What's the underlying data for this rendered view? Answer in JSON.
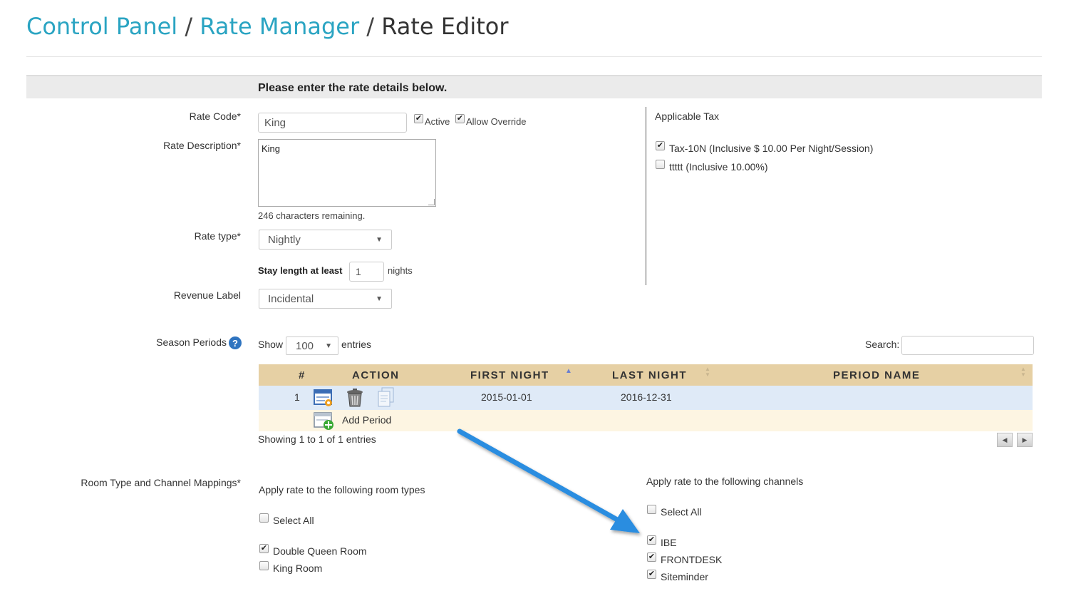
{
  "breadcrumb": {
    "control_panel": "Control Panel",
    "rate_manager": "Rate Manager",
    "rate_editor": "Rate Editor",
    "separator": "/"
  },
  "banner": {
    "text": "Please enter the rate details below."
  },
  "form": {
    "rate_code": {
      "label": "Rate Code*",
      "value": "King",
      "active_label": "Active",
      "active_checked": true,
      "allow_override_label": "Allow Override",
      "allow_override_checked": true
    },
    "rate_description": {
      "label": "Rate Description*",
      "value": "King",
      "remaining": "246 characters remaining."
    },
    "rate_type": {
      "label": "Rate type*",
      "value": "Nightly"
    },
    "stay_length": {
      "label": "Stay length at least",
      "value": "1",
      "unit": "nights"
    },
    "revenue_label": {
      "label": "Revenue Label",
      "value": "Incidental"
    }
  },
  "tax": {
    "title": "Applicable Tax",
    "items": [
      {
        "label": "Tax-10N (Inclusive $ 10.00 Per Night/Session)",
        "checked": true
      },
      {
        "label": "ttttt (Inclusive 10.00%)",
        "checked": false
      }
    ]
  },
  "season": {
    "label": "Season Periods",
    "show_label": "Show",
    "page_size": "100",
    "entries_label": "entries",
    "search_label": "Search:",
    "search_value": "",
    "columns": [
      "#",
      "ACTION",
      "FIRST NIGHT",
      "LAST NIGHT",
      "PERIOD NAME"
    ],
    "rows": [
      {
        "num": "1",
        "first_night": "2015-01-01",
        "last_night": "2016-12-31",
        "period_name": ""
      }
    ],
    "add_period": "Add Period",
    "info": "Showing 1 to 1 of 1 entries"
  },
  "mappings": {
    "label": "Room Type and Channel Mappings*",
    "rooms_title": "Apply rate to the following room types",
    "rooms_select_all": "Select All",
    "rooms": [
      {
        "label": "Double Queen Room",
        "checked": true
      },
      {
        "label": "King Room",
        "checked": false
      }
    ],
    "channels_title": "Apply rate to the following channels",
    "channels_select_all": "Select All",
    "channels": [
      {
        "label": "IBE",
        "checked": true
      },
      {
        "label": "FRONTDESK",
        "checked": true
      },
      {
        "label": "Siteminder",
        "checked": true
      }
    ]
  },
  "colors": {
    "link": "#2aa4c2",
    "table_header": "#e6d0a4",
    "row_selected": "#dfeaf7",
    "row_alt": "#fdf5e2",
    "arrow": "#2b8de0"
  },
  "icons": {
    "edit": "edit-period-icon",
    "delete": "trash-icon",
    "copy": "copy-icon",
    "add": "add-period-icon",
    "help": "help-icon"
  }
}
